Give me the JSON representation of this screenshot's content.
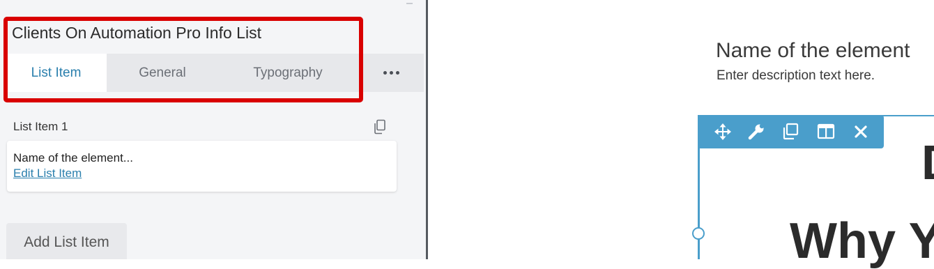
{
  "panel": {
    "title": "Clients On Automation Pro Info List",
    "tabs": [
      {
        "label": "List Item",
        "active": true
      },
      {
        "label": "General",
        "active": false
      },
      {
        "label": "Typography",
        "active": false
      }
    ],
    "more_icon": "more-dots-icon",
    "list_items": [
      {
        "header": "List Item 1",
        "name": "Name of the element...",
        "edit_label": "Edit List Item"
      }
    ],
    "add_label": "Add List Item"
  },
  "canvas": {
    "element_name": "Name of the element",
    "element_description": "Enter description text here.",
    "toolbar_icons": [
      "move-icon",
      "wrench-icon",
      "duplicate-icon",
      "columns-icon",
      "close-icon"
    ],
    "partial_letter": "D",
    "partial_heading": "Why Y"
  },
  "colors": {
    "accent": "#4a9ecb",
    "highlight": "#d90000",
    "link": "#2a7fad"
  }
}
